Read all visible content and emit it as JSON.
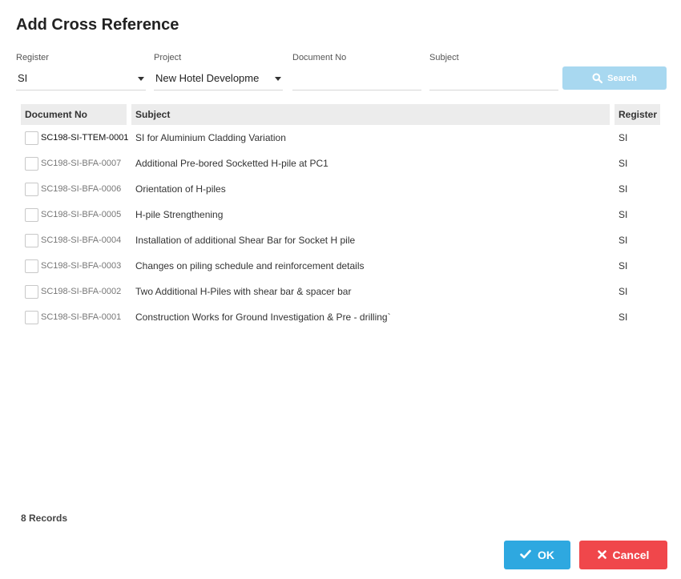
{
  "dialog": {
    "title": "Add Cross Reference"
  },
  "filters": {
    "register": {
      "label": "Register",
      "value": "SI"
    },
    "project": {
      "label": "Project",
      "value": "New Hotel Developme"
    },
    "document_no": {
      "label": "Document No",
      "value": ""
    },
    "subject": {
      "label": "Subject",
      "value": ""
    },
    "search_label": "Search"
  },
  "table": {
    "columns": [
      "Document No",
      "Subject",
      "Register"
    ],
    "rows": [
      {
        "document_no": "SC198-SI-TTEM-0001",
        "subject": "SI for Aluminium Cladding Variation",
        "register": "SI",
        "checked": false
      },
      {
        "document_no": "SC198-SI-BFA-0007",
        "subject": "Additional Pre-bored Socketted H-pile at PC1",
        "register": "SI",
        "checked": false
      },
      {
        "document_no": "SC198-SI-BFA-0006",
        "subject": "Orientation of H-piles",
        "register": "SI",
        "checked": false
      },
      {
        "document_no": "SC198-SI-BFA-0005",
        "subject": "H-pile Strengthening",
        "register": "SI",
        "checked": false
      },
      {
        "document_no": "SC198-SI-BFA-0004",
        "subject": "Installation of additional Shear Bar for Socket H pile",
        "register": "SI",
        "checked": false
      },
      {
        "document_no": "SC198-SI-BFA-0003",
        "subject": "Changes on piling schedule and reinforcement details",
        "register": "SI",
        "checked": false
      },
      {
        "document_no": "SC198-SI-BFA-0002",
        "subject": "Two Additional H-Piles with shear bar & spacer bar",
        "register": "SI",
        "checked": false
      },
      {
        "document_no": "SC198-SI-BFA-0001",
        "subject": "Construction Works for Ground Investigation & Pre - drilling`",
        "register": "SI",
        "checked": false
      }
    ]
  },
  "footer": {
    "records": "8 Records",
    "ok_label": "OK",
    "cancel_label": "Cancel"
  },
  "colors": {
    "search_button": "#a8d8f0",
    "ok_button": "#2ea8e0",
    "cancel_button": "#f0474b",
    "header_background": "#ececec"
  },
  "icons": {
    "search": "search-icon",
    "ok": "check-icon",
    "cancel": "close-icon",
    "dropdown": "caret-down-icon"
  }
}
